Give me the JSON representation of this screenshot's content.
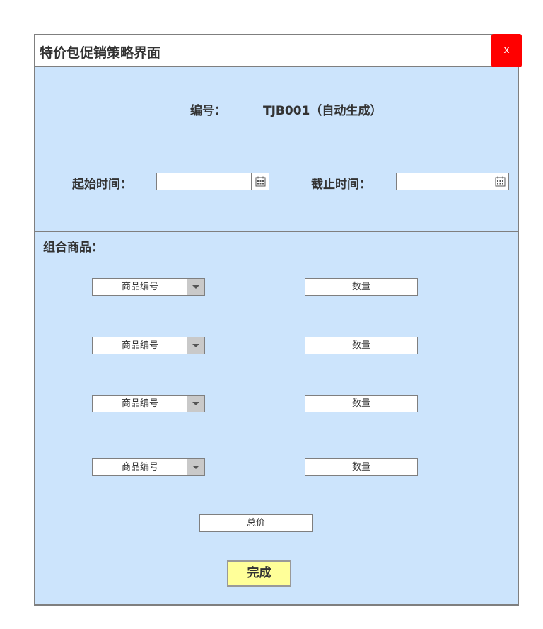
{
  "window": {
    "title": "特价包促销策略界面",
    "close_label": "x"
  },
  "id_field": {
    "label": "编号：",
    "value": "TJB001（自动生成）"
  },
  "time": {
    "start_label": "起始时间：",
    "end_label": "截止时间：",
    "start_value": "",
    "end_value": ""
  },
  "combo": {
    "label": "组合商品：",
    "rows": [
      {
        "product_select": "商品编号",
        "quantity_placeholder": "数量"
      },
      {
        "product_select": "商品编号",
        "quantity_placeholder": "数量"
      },
      {
        "product_select": "商品编号",
        "quantity_placeholder": "数量"
      },
      {
        "product_select": "商品编号",
        "quantity_placeholder": "数量"
      }
    ]
  },
  "total": {
    "placeholder": "总价"
  },
  "actions": {
    "done_label": "完成"
  },
  "icons": {
    "calendar": "calendar-icon",
    "dropdown": "chevron-down-icon"
  },
  "colors": {
    "panel_bg": "#cce4fc",
    "close_bg": "#ff0000",
    "done_bg": "#ffff99",
    "border": "#7f7f7f"
  }
}
